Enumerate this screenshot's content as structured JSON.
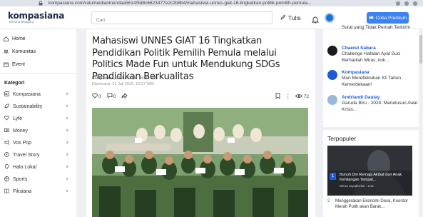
{
  "browser": {
    "url": "kompasiana.com/ratumeidianinendaa5614/5d8c6623477e2c2b8b4/mahasiswi-unnes-giat-16-tingkatkan-politik-pemilih-pemula..."
  },
  "header": {
    "brand": "kompasiana",
    "tagline": "Beyond Blogging",
    "search_placeholder": "Cari",
    "write_label": "Tulis",
    "premium_label": "Coba Premium",
    "colors": {
      "accent": "#3b82f6",
      "brand": "#1c2a4a"
    }
  },
  "left_nav": {
    "items": [
      {
        "label": "Home",
        "icon": "home-icon"
      },
      {
        "label": "Komunitas",
        "icon": "community-icon"
      },
      {
        "label": "Event",
        "icon": "event-icon"
      }
    ],
    "kategori_title": "Kategori",
    "categories": [
      {
        "label": "Kompasiana",
        "icon": "kompasiana-icon"
      },
      {
        "label": "Sustainability",
        "icon": "leaf-icon"
      },
      {
        "label": "Lyfe",
        "icon": "heart-icon"
      },
      {
        "label": "Money",
        "icon": "money-icon"
      },
      {
        "label": "Vox Pop",
        "icon": "megaphone-icon"
      },
      {
        "label": "Travel Story",
        "icon": "travel-icon"
      },
      {
        "label": "Halo Lokal",
        "icon": "location-icon"
      },
      {
        "label": "Sports",
        "icon": "sports-icon"
      },
      {
        "label": "Fiksiana",
        "icon": "book-icon"
      }
    ]
  },
  "article": {
    "title": "Mahasiswi UNNES GIAT 16 Tingkatkan Pendidikan Politik Pemilih Pemula melalui Politics Made Fun untuk Mendukung SDGs Pendidikan Berkualitas",
    "published": "Kompasiana, 31 Juli 2026, 10:27 WIB",
    "updated": "Diperbarui: 31 Juli 2026, 10:27 WIB",
    "reactions": {
      "likes": "0",
      "comments": "0"
    },
    "views": "72"
  },
  "right_sidebar": {
    "notifications": [
      {
        "name": "",
        "text": "Surat yang Tidak Pernah Terkirim"
      },
      {
        "name": "Chaerul Sabara",
        "text": "Challenge Hafalan Ayat Suci Berhadiah Miras, kok..."
      },
      {
        "name": "Kompasiana",
        "text": "Mari Merefleksikan 81 Tahun Kemerdekaan!"
      },
      {
        "name": "Andriandi Daulay",
        "text": "Garuda Biru - 2024: Menelusuri Awal Krisis..."
      }
    ],
    "popular_title": "Terpopuler",
    "popular": [
      {
        "rank": "1",
        "title": "Bunuh Diri Remaja Akibat dari Anak Kehilangan Tempat...",
        "meta": "Dimas Jayadinekat · 1121"
      },
      {
        "rank": "2",
        "title": "Menggerakan Ekonomi Desa, Koordor Merah Putih akan Barak..."
      }
    ]
  }
}
